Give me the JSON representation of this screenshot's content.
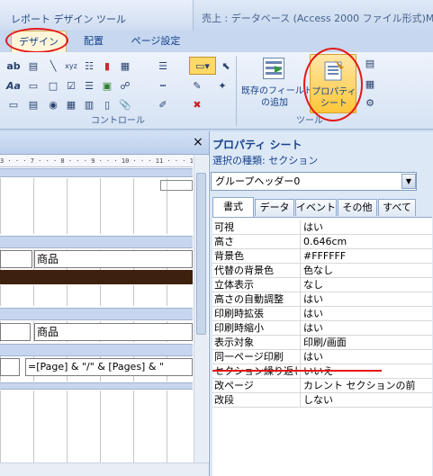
{
  "app": {
    "context_title": "レポート デザイン ツール",
    "window_title": "売上 : データベース (Access 2000 ファイル形式)M..."
  },
  "ribbon_tabs": [
    "デザイン",
    "配置",
    "ページ設定"
  ],
  "ribbon": {
    "groups": [
      "コントロール",
      "ツール"
    ],
    "add_field_label_1": "既存のフィールド",
    "add_field_label_2": "の追加",
    "property_label_1": "プロパティ",
    "property_label_2": "シート"
  },
  "left_pane": {
    "close_glyph": "×",
    "ruler": "3 · · · 7 · · · 8 · · · 9 · · · 10 · · · 11 · · · 12 · · ·",
    "label_shohin_1": "商品",
    "label_shohin_2": "商品",
    "page_expr": "=[Page] & \"/\" & [Pages] & \""
  },
  "property_sheet": {
    "title": "プロパティ シート",
    "selection_type": "選択の種類: セクション",
    "selected_object": "グループヘッダー0",
    "tabs": [
      "書式",
      "データ",
      "イベント",
      "その他",
      "すべて"
    ],
    "rows": [
      {
        "name": "可視",
        "value": "はい"
      },
      {
        "name": "高さ",
        "value": "0.646cm"
      },
      {
        "name": "背景色",
        "value": "#FFFFFF"
      },
      {
        "name": "代替の背景色",
        "value": "色なし"
      },
      {
        "name": "立体表示",
        "value": "なし"
      },
      {
        "name": "高さの自動調整",
        "value": "はい"
      },
      {
        "name": "印刷時拡張",
        "value": "はい"
      },
      {
        "name": "印刷時縮小",
        "value": "はい"
      },
      {
        "name": "表示対象",
        "value": "印刷/画面"
      },
      {
        "name": "同一ページ印刷",
        "value": "はい"
      },
      {
        "name": "セクション繰り返し",
        "value": "いいえ"
      },
      {
        "name": "改ページ",
        "value": "カレント セクションの前"
      },
      {
        "name": "改段",
        "value": "しない"
      }
    ]
  },
  "colors": {
    "ribbon_blue": "#15428b",
    "highlight_red": "#e41818",
    "band_blue": "#c7d6ee"
  }
}
